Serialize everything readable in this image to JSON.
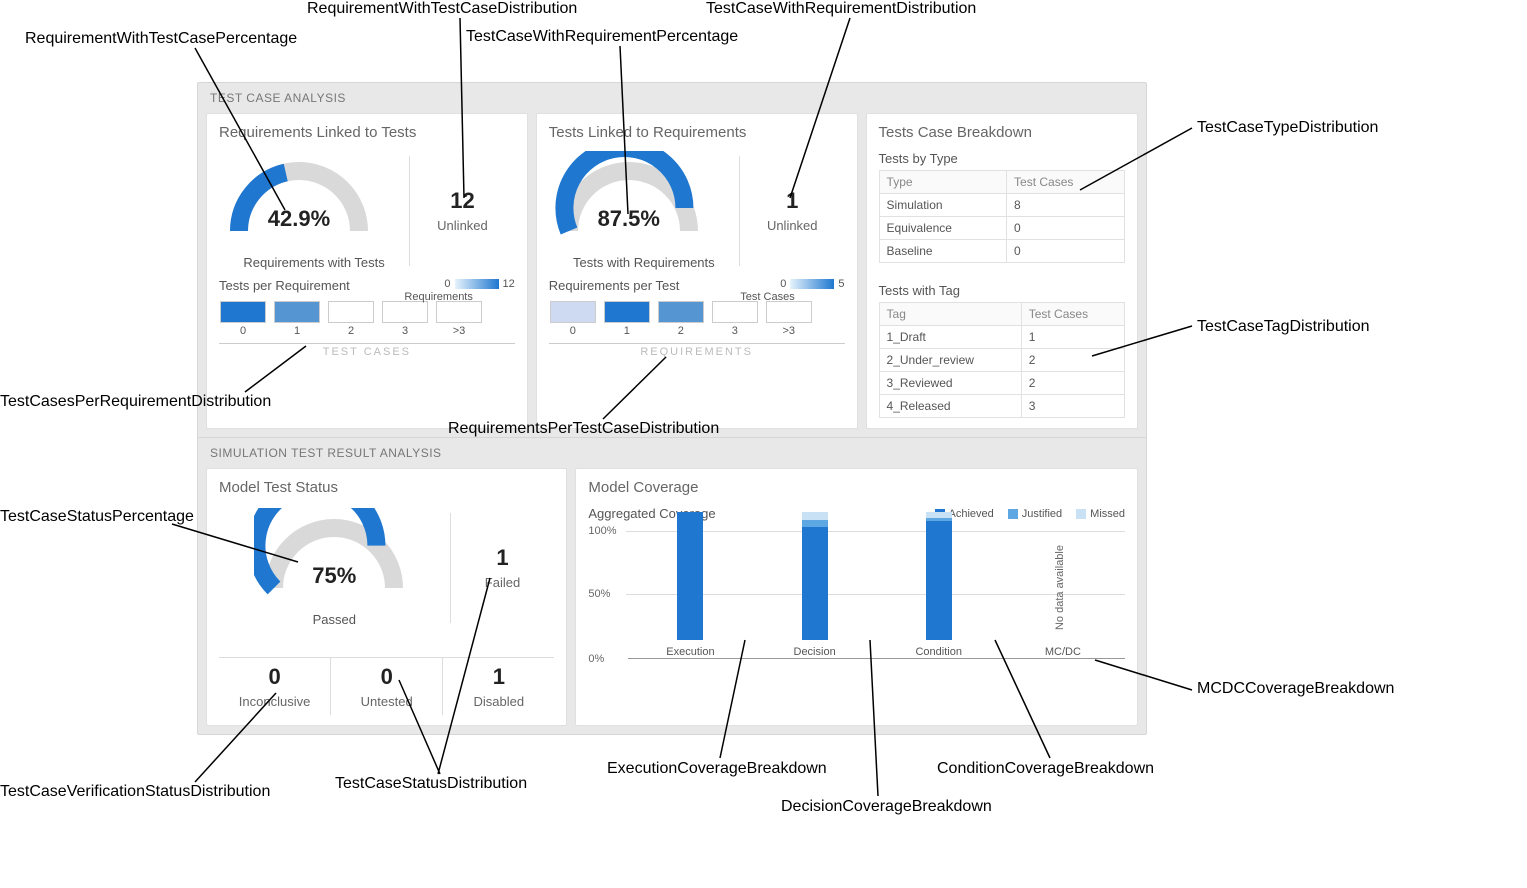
{
  "colors": {
    "primary": "#1f77d0",
    "light": "#8dbfe8",
    "pale": "#c8e1f5"
  },
  "annotations": {
    "RequirementWithTestCasePercentage": "RequirementWithTestCasePercentage",
    "RequirementWithTestCaseDistribution": "RequirementWithTestCaseDistribution",
    "TestCaseWithRequirementPercentage": "TestCaseWithRequirementPercentage",
    "TestCaseWithRequirementDistribution": "TestCaseWithRequirementDistribution",
    "TestCaseTypeDistribution": "TestCaseTypeDistribution",
    "TestCaseTagDistribution": "TestCaseTagDistribution",
    "TestCasesPerRequirementDistribution": "TestCasesPerRequirementDistribution",
    "RequirementsPerTestCaseDistribution": "RequirementsPerTestCaseDistribution",
    "TestCaseStatusPercentage": "TestCaseStatusPercentage",
    "TestCaseVerificationStatusDistribution": "TestCaseVerificationStatusDistribution",
    "TestCaseStatusDistribution": "TestCaseStatusDistribution",
    "ExecutionCoverageBreakdown": "ExecutionCoverageBreakdown",
    "DecisionCoverageBreakdown": "DecisionCoverageBreakdown",
    "ConditionCoverageBreakdown": "ConditionCoverageBreakdown",
    "MCDCCoverageBreakdown": "MCDCCoverageBreakdown"
  },
  "panels": {
    "testCaseAnalysis": {
      "hdr": "TEST CASE ANALYSIS"
    },
    "simResults": {
      "hdr": "SIMULATION TEST RESULT ANALYSIS"
    }
  },
  "reqLinked": {
    "title": "Requirements Linked to Tests",
    "pct": "42.9%",
    "pctVal": 42.9,
    "pctLabel": "Requirements with Tests",
    "unlinkedCount": "12",
    "unlinkedLabel": "Unlinked",
    "heat": {
      "title": "Tests per Requirement",
      "legMin": "0",
      "legMax": "12",
      "legLabel": "Requirements",
      "axis": "TEST CASES",
      "cells": [
        {
          "label": "0",
          "v": 12
        },
        {
          "label": "1",
          "v": 7
        },
        {
          "label": "2",
          "v": 0
        },
        {
          "label": "3",
          "v": 0
        },
        {
          "label": ">3",
          "v": 0
        }
      ]
    }
  },
  "testsLinked": {
    "title": "Tests Linked to Requirements",
    "pct": "87.5%",
    "pctVal": 87.5,
    "pctLabel": "Tests with Requirements",
    "unlinkedCount": "1",
    "unlinkedLabel": "Unlinked",
    "heat": {
      "title": "Requirements per Test",
      "legMin": "0",
      "legMax": "5",
      "legLabel": "Test Cases",
      "axis": "REQUIREMENTS",
      "cells": [
        {
          "label": "0",
          "v": 1
        },
        {
          "label": "1",
          "v": 5
        },
        {
          "label": "2",
          "v": 2
        },
        {
          "label": "3",
          "v": 0
        },
        {
          "label": ">3",
          "v": 0
        }
      ]
    }
  },
  "breakdown": {
    "title": "Tests Case Breakdown",
    "byType": {
      "title": "Tests by Type",
      "col0": "Type",
      "col1": "Test Cases",
      "rows": [
        {
          "a": "Simulation",
          "b": "8"
        },
        {
          "a": "Equivalence",
          "b": "0"
        },
        {
          "a": "Baseline",
          "b": "0"
        }
      ]
    },
    "byTag": {
      "title": "Tests with Tag",
      "col0": "Tag",
      "col1": "Test Cases",
      "rows": [
        {
          "a": "1_Draft",
          "b": "1"
        },
        {
          "a": "2_Under_review",
          "b": "2"
        },
        {
          "a": "3_Reviewed",
          "b": "2"
        },
        {
          "a": "4_Released",
          "b": "3"
        }
      ]
    }
  },
  "status": {
    "title": "Model Test Status",
    "pct": "75%",
    "pctVal": 75,
    "pctLabel": "Passed",
    "right": {
      "n": "1",
      "lbl": "Failed"
    },
    "cells": [
      {
        "n": "0",
        "lbl": "Inconclusive"
      },
      {
        "n": "0",
        "lbl": "Untested"
      },
      {
        "n": "1",
        "lbl": "Disabled"
      }
    ]
  },
  "coverage": {
    "title": "Model Coverage",
    "subtitle": "Aggregated Coverage",
    "legend": {
      "l0": "Achieved",
      "l1": "Justified",
      "l2": "Missed"
    },
    "yTicks": [
      "100%",
      "50%",
      "0%"
    ],
    "noData": "No data available",
    "bars": [
      {
        "label": "Execution",
        "achieved": 100,
        "justified": 0,
        "missed": 0
      },
      {
        "label": "Decision",
        "achieved": 88,
        "justified": 6,
        "missed": 6
      },
      {
        "label": "Condition",
        "achieved": 93,
        "justified": 2,
        "missed": 5
      },
      {
        "label": "MC/DC",
        "nodata": true
      }
    ]
  },
  "chart_data": [
    {
      "type": "gauge",
      "title": "Requirements with Tests",
      "value": 42.9,
      "max": 100,
      "unit": "%"
    },
    {
      "type": "gauge",
      "title": "Tests with Requirements",
      "value": 87.5,
      "max": 100,
      "unit": "%"
    },
    {
      "type": "heatmap",
      "title": "Tests per Requirement",
      "categories": [
        "0",
        "1",
        "2",
        "3",
        ">3"
      ],
      "values": [
        12,
        7,
        0,
        0,
        0
      ],
      "xlabel": "TEST CASES",
      "legend": "Requirements",
      "range": [
        0,
        12
      ]
    },
    {
      "type": "heatmap",
      "title": "Requirements per Test",
      "categories": [
        "0",
        "1",
        "2",
        "3",
        ">3"
      ],
      "values": [
        1,
        5,
        2,
        0,
        0
      ],
      "xlabel": "REQUIREMENTS",
      "legend": "Test Cases",
      "range": [
        0,
        5
      ]
    },
    {
      "type": "table",
      "title": "Tests by Type",
      "columns": [
        "Type",
        "Test Cases"
      ],
      "rows": [
        [
          "Simulation",
          8
        ],
        [
          "Equivalence",
          0
        ],
        [
          "Baseline",
          0
        ]
      ]
    },
    {
      "type": "table",
      "title": "Tests with Tag",
      "columns": [
        "Tag",
        "Test Cases"
      ],
      "rows": [
        [
          "1_Draft",
          1
        ],
        [
          "2_Under_review",
          2
        ],
        [
          "3_Reviewed",
          2
        ],
        [
          "4_Released",
          3
        ]
      ]
    },
    {
      "type": "gauge",
      "title": "Passed",
      "value": 75,
      "max": 100,
      "unit": "%"
    },
    {
      "type": "bar",
      "title": "Aggregated Coverage",
      "categories": [
        "Execution",
        "Decision",
        "Condition",
        "MC/DC"
      ],
      "series": [
        {
          "name": "Achieved",
          "values": [
            100,
            88,
            93,
            null
          ]
        },
        {
          "name": "Justified",
          "values": [
            0,
            6,
            2,
            null
          ]
        },
        {
          "name": "Missed",
          "values": [
            0,
            6,
            5,
            null
          ]
        }
      ],
      "ylim": [
        0,
        100
      ],
      "ylabel": "%"
    }
  ]
}
